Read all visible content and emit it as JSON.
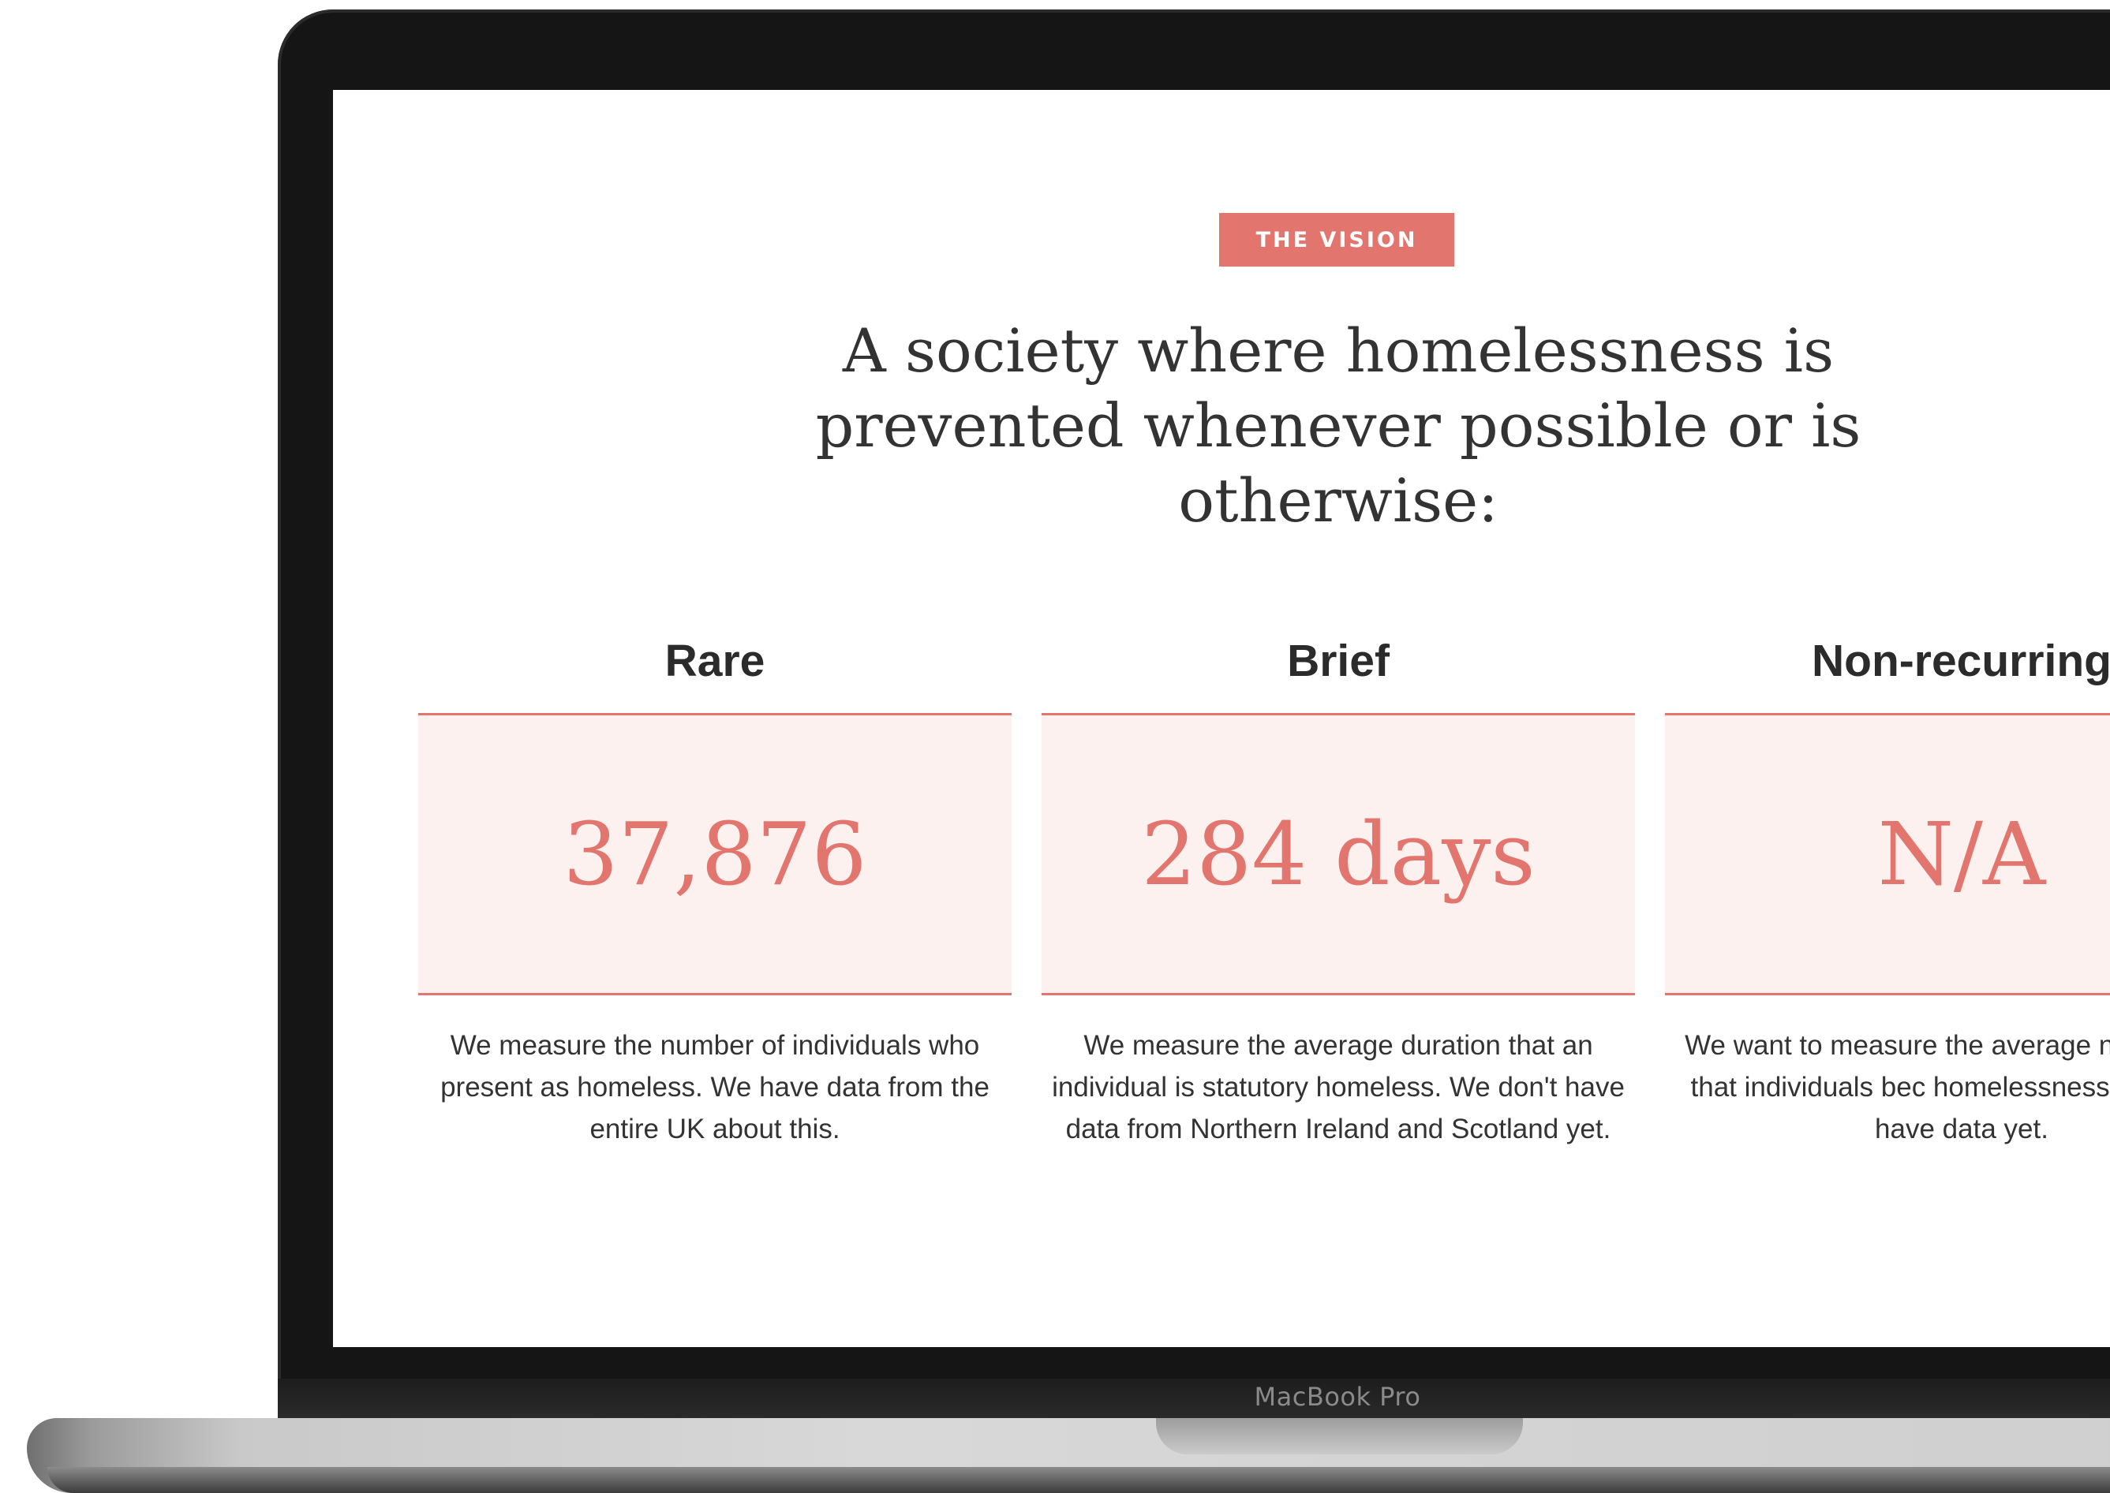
{
  "device": {
    "brand_label": "MacBook Pro"
  },
  "page": {
    "badge": "THE VISION",
    "headline": "A society where homelessness is prevented whenever possible or is otherwise:"
  },
  "metrics": [
    {
      "title": "Rare",
      "value": "37,876",
      "description": "We measure the number of individuals who present as homeless. We have data from the entire UK about this."
    },
    {
      "title": "Brief",
      "value": "284 days",
      "description": "We measure the average duration that an individual is statutory homeless. We don't have data from Northern Ireland and Scotland yet."
    },
    {
      "title": "Non-recurring",
      "value": "N/A",
      "description": "We want to measure the average n instances that individuals bec homelessness. We don't have data yet."
    }
  ],
  "colors": {
    "accent": "#e2756d",
    "box_background": "#fdf1f0",
    "text": "#333333"
  }
}
